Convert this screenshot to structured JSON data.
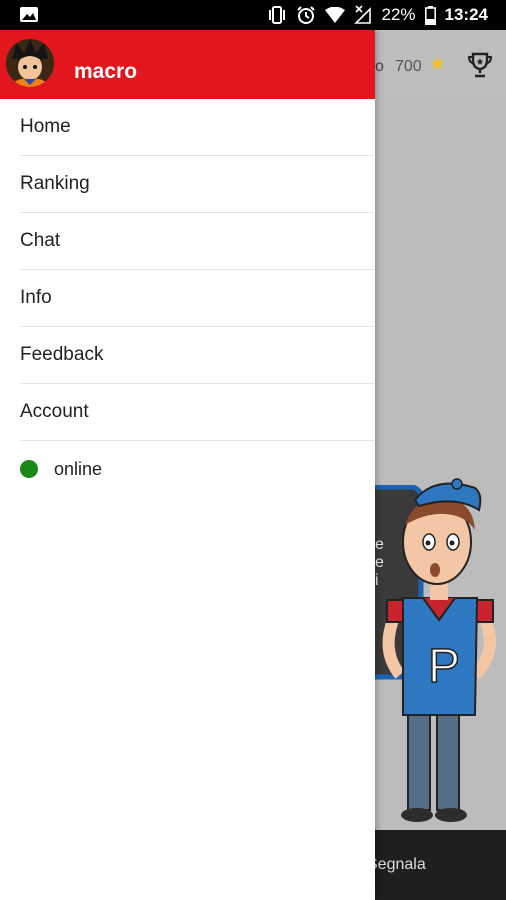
{
  "statusbar": {
    "battery_percent": "22%",
    "time": "13:24",
    "icons": [
      "image-icon",
      "vibrate-icon",
      "alarm-icon",
      "wifi-icon",
      "no-signal-icon",
      "battery-icon"
    ]
  },
  "drawer": {
    "username": "macro",
    "avatar": "avatar-goku",
    "menu": [
      {
        "label": "Home"
      },
      {
        "label": "Ranking"
      },
      {
        "label": "Chat"
      },
      {
        "label": "Info"
      },
      {
        "label": "Feedback"
      },
      {
        "label": "Account"
      }
    ],
    "status": {
      "label": "online",
      "color": "#1a8a16"
    }
  },
  "background": {
    "header_fragment": "o",
    "points": "700",
    "footer_fragment": "Segnala",
    "mascot_letter": "P",
    "bubble_fragment": [
      "e",
      "e",
      "i"
    ]
  },
  "colors": {
    "accent": "#e3161e",
    "star": "#f2c12e"
  }
}
